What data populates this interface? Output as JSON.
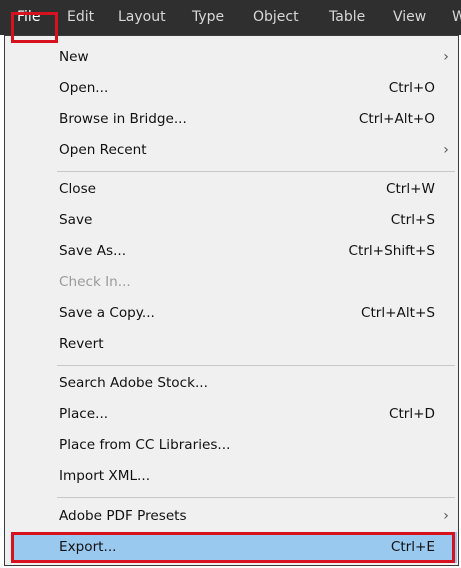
{
  "menubar": {
    "items": [
      "File",
      "Edit",
      "Layout",
      "Type",
      "Object",
      "Table",
      "View",
      "W"
    ]
  },
  "menu": {
    "new": {
      "label": "New"
    },
    "open": {
      "label": "Open...",
      "shortcut": "Ctrl+O"
    },
    "browse_in_bridge": {
      "label": "Browse in Bridge...",
      "shortcut": "Ctrl+Alt+O"
    },
    "open_recent": {
      "label": "Open Recent"
    },
    "close": {
      "label": "Close",
      "shortcut": "Ctrl+W"
    },
    "save": {
      "label": "Save",
      "shortcut": "Ctrl+S"
    },
    "save_as": {
      "label": "Save As...",
      "shortcut": "Ctrl+Shift+S"
    },
    "check_in": {
      "label": "Check In..."
    },
    "save_a_copy": {
      "label": "Save a Copy...",
      "shortcut": "Ctrl+Alt+S"
    },
    "revert": {
      "label": "Revert"
    },
    "search_adobe_stock": {
      "label": "Search Adobe Stock..."
    },
    "place": {
      "label": "Place...",
      "shortcut": "Ctrl+D"
    },
    "place_from_cc_libraries": {
      "label": "Place from CC Libraries..."
    },
    "import_xml": {
      "label": "Import XML..."
    },
    "adobe_pdf_presets": {
      "label": "Adobe PDF Presets"
    },
    "export": {
      "label": "Export...",
      "shortcut": "Ctrl+E"
    }
  },
  "submenu_glyph": "›",
  "colors": {
    "menubar_bg": "#2f2f2f",
    "menu_bg": "#f0f0f0",
    "selected_bg": "#99c9ef",
    "highlight_border": "#d7111e",
    "disabled_text": "#9a9a9a"
  }
}
